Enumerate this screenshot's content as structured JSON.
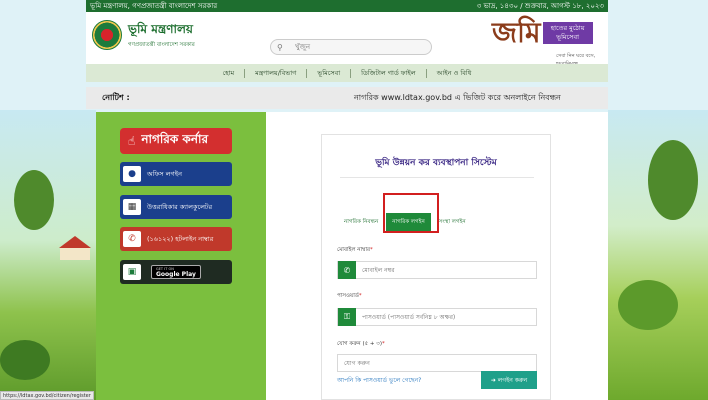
{
  "topbar": {
    "left": "ভূমি মন্ত্রণালয়, গণপ্রজাতন্ত্রী বাংলাদেশ সরকার",
    "right": "৩ ভাদ্র, ১৪৩০ / শুক্রবার, আগস্ট ১৮, ২০২৩"
  },
  "header": {
    "logo_title": "ভূমি মন্ত্রণালয়",
    "logo_subtitle": "গণপ্রজাতন্ত্রী বাংলাদেশ সরকার",
    "search_placeholder": "খুঁজুন",
    "brand_word": "জমি",
    "brand_tag": "হাতের মুঠোয় ভূমিসেবা",
    "brand_sub": "সেবা নিন ঘরে বসে, হয়রানিমুক্ত"
  },
  "nav": {
    "items": [
      "হোম",
      "মন্ত্রণালয়/বিভাগ",
      "ভূমিসেবা",
      "ডিজিটাল গার্ড ফাইল",
      "আইন ও বিধি"
    ]
  },
  "notice": {
    "label": "নোটিশ :",
    "text": "নাগরিক www.ldtax.gov.bd এ ভিজিট করে অনলাইনে নিবন্ধন"
  },
  "sidebar": {
    "corner_label": "নাগরিক কর্নার",
    "office_login": "অফিস লগইন",
    "calculator": "উত্তরাধিকার ক্যালকুলেটর",
    "hotline": "(১৬১২২) হটলাইন নাম্বার",
    "gplay_small": "GET IT ON",
    "gplay_big": "Google Play"
  },
  "login": {
    "title": "ভূমি উন্নয়ন কর ব্যবস্থাপনা সিস্টেম",
    "tabs": [
      "নাগরিক নিবন্ধন",
      "নাগরিক লগইন",
      "সংস্থা লগইন"
    ],
    "mobile_label": "মোবাইল নাম্বার",
    "mobile_placeholder": "মোবাইল নম্বর",
    "password_label": "পাসওয়ার্ড",
    "password_placeholder": "পাসওয়ার্ড (পাসওয়ার্ড সর্বনিম্ন ৮ অক্ষর)",
    "captcha_label": "যোগ করুন (৫ + ৩)",
    "captcha_placeholder": "যোগ করুন",
    "forgot": "আপনি কি পাসওয়ার্ড ভুলে গেছেন?",
    "submit": "লগইন করুন",
    "required_mark": "*"
  },
  "status_url": "https://ldtax.gov.bd/citizen/register",
  "colors": {
    "accent": "#1f8a3a",
    "sidebar": "#7bbf3e",
    "highlight": "#d21f1f"
  }
}
